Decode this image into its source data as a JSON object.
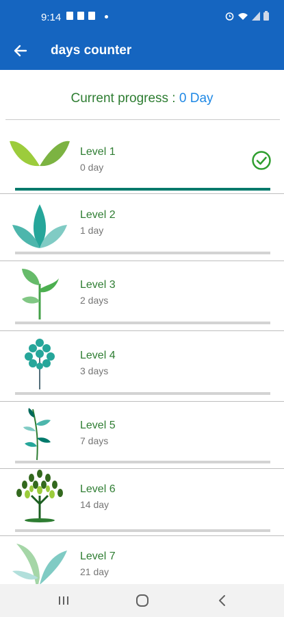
{
  "status": {
    "time": "9:14",
    "icons": [
      "image-icon",
      "sim-icon",
      "battery-saver-icon",
      "dot-icon",
      "alarm-icon",
      "wifi-icon",
      "signal-icon",
      "battery-icon"
    ]
  },
  "appbar": {
    "title": "days counter",
    "back_icon": "arrow-left-icon"
  },
  "progress": {
    "label": "Current progress : ",
    "value": "0 Day"
  },
  "colors": {
    "primary": "#1565c0",
    "green_text": "#2e7d32",
    "accent_blue": "#1e88e5",
    "progress_fill": "#00796b",
    "check": "#2e9e2e"
  },
  "levels": [
    {
      "label": "Level 1",
      "days": "0 day",
      "icon": "two-leaves-icon",
      "complete": true,
      "progress": 1.0
    },
    {
      "label": "Level 2",
      "days": "1 day",
      "icon": "sprout-leaves-icon",
      "complete": false,
      "progress": 0
    },
    {
      "label": "Level 3",
      "days": "2 days",
      "icon": "seedling-icon",
      "complete": false,
      "progress": 0
    },
    {
      "label": "Level 4",
      "days": "3 days",
      "icon": "small-tree-icon",
      "complete": false,
      "progress": 0
    },
    {
      "label": "Level 5",
      "days": "7 days",
      "icon": "branch-plant-icon",
      "complete": false,
      "progress": 0
    },
    {
      "label": "Level 6",
      "days": "14 day",
      "icon": "leafy-tree-icon",
      "complete": false,
      "progress": 0
    },
    {
      "label": "Level 7",
      "days": "21 day",
      "icon": "palm-plant-icon",
      "complete": false,
      "progress": 0
    }
  ],
  "navbar": {
    "recent_icon": "recent-apps-icon",
    "home_icon": "home-icon",
    "back_icon": "back-chevron-icon"
  }
}
